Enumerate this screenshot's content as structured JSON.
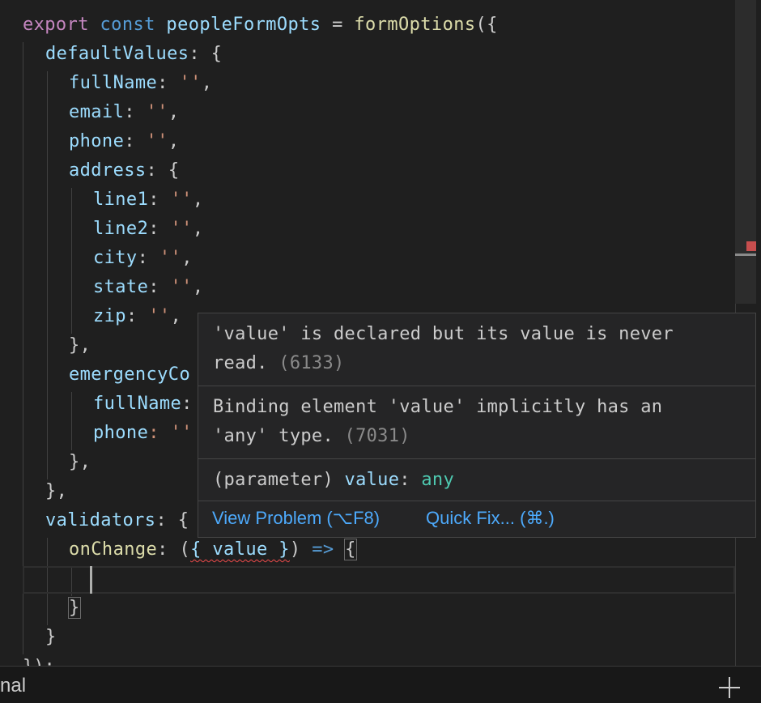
{
  "code": {
    "l1": {
      "kw": "export",
      "st": "const",
      "var": "peopleFormOpts",
      "eq": " = ",
      "fn": "formOptions",
      "open": "({"
    },
    "l2": {
      "prop": "defaultValues",
      "rest": ": {"
    },
    "l3": {
      "prop": "fullName",
      "str": "''",
      "rest": ","
    },
    "l4": {
      "prop": "email",
      "str": "''",
      "rest": ","
    },
    "l5": {
      "prop": "phone",
      "str": "''",
      "rest": ","
    },
    "l6": {
      "prop": "address",
      "rest": ": {"
    },
    "l7": {
      "prop": "line1",
      "str": "''",
      "rest": ","
    },
    "l8": {
      "prop": "line2",
      "str": "''",
      "rest": ","
    },
    "l9": {
      "prop": "city",
      "str": "''",
      "rest": ","
    },
    "l10": {
      "prop": "state",
      "str": "''",
      "rest": ","
    },
    "l11": {
      "prop": "zip",
      "str": "''",
      "rest": ","
    },
    "l12": "},",
    "l13": {
      "prop": "emergencyCo"
    },
    "l14": {
      "prop": "fullName",
      "rest": ":"
    },
    "l15": {
      "prop": "phone",
      "rest": ": ''"
    },
    "l16": "},",
    "l17": "},",
    "l18": {
      "prop": "validators",
      "rest": ": {"
    },
    "l19": {
      "fn": "onChange",
      "colon": ": (",
      "destructure": "{ value }",
      "close": ")",
      "arrow": " => ",
      "brace": "{"
    },
    "l21": "}",
    "l22": "}",
    "l23": "});"
  },
  "hover": {
    "msg1_line1": "'value' is declared but its value is never",
    "msg1_line2": "read.",
    "msg1_code": "(6133)",
    "msg2_line1": "Binding element 'value' implicitly has an",
    "msg2_line2": "'any' type.",
    "msg2_code": "(7031)",
    "sig_param": "(parameter)",
    "sig_name": "value",
    "sig_type": "any",
    "view_problem": "View Problem (⌥F8)",
    "quick_fix": "Quick Fix... (⌘.)"
  },
  "panel": {
    "tab_label": "nal"
  }
}
